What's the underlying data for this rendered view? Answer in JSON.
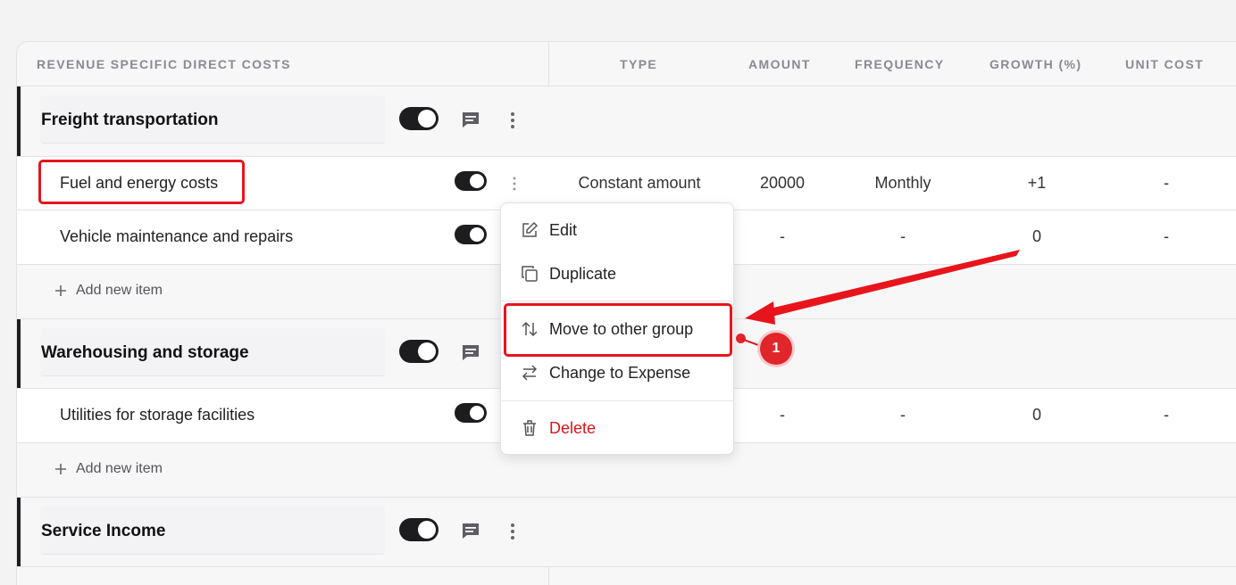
{
  "header": {
    "section_title": "REVENUE SPECIFIC DIRECT COSTS",
    "columns": [
      "TYPE",
      "AMOUNT",
      "FREQUENCY",
      "GROWTH (%)",
      "UNIT COST"
    ]
  },
  "groups": [
    {
      "title": "Freight transportation",
      "items": [
        {
          "name": "Fuel and energy costs",
          "type": "Constant amount",
          "amount": "20000",
          "frequency": "Monthly",
          "growth": "+1",
          "unit_cost": "-"
        },
        {
          "name": "Vehicle maintenance and repairs",
          "type": "",
          "amount": "-",
          "frequency": "-",
          "growth": "0",
          "unit_cost": "-"
        }
      ],
      "add_label": "Add new item"
    },
    {
      "title": "Warehousing and storage",
      "items": [
        {
          "name": "Utilities for storage facilities",
          "type": "",
          "amount": "-",
          "frequency": "-",
          "growth": "0",
          "unit_cost": "-"
        }
      ],
      "add_label": "Add new item"
    },
    {
      "title": "Service Income",
      "items": []
    }
  ],
  "context_menu": {
    "items": [
      {
        "label": "Edit",
        "icon": "edit-icon"
      },
      {
        "label": "Duplicate",
        "icon": "duplicate-icon"
      },
      {
        "label": "Move to other group",
        "icon": "swap-vertical-icon"
      },
      {
        "label": "Change to Expense",
        "icon": "swap-horizontal-icon"
      },
      {
        "label": "Delete",
        "icon": "trash-icon"
      }
    ]
  },
  "annotation": {
    "badge": "1"
  },
  "colors": {
    "accent_red": "#e8141c",
    "toggle_on": "#1d1d20",
    "delete_red": "#d9141c"
  }
}
